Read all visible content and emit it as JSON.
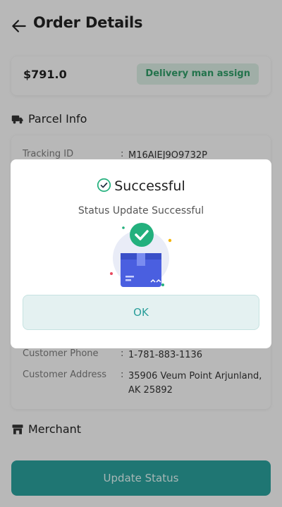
{
  "header": {
    "title": "Order Details"
  },
  "summary": {
    "price": "$791.0",
    "status": "Delivery man assign"
  },
  "parcel_info": {
    "title": "Parcel Info",
    "rows": [
      {
        "label": "Tracking ID",
        "value": "M16AIEJ9O9732P"
      },
      {
        "label": "Customer Phone",
        "value": "1-781-883-1136"
      },
      {
        "label": "Customer Address",
        "value": "35906 Veum Point Arjunland, AK 25892"
      }
    ]
  },
  "merchant": {
    "title": "Merchant"
  },
  "actions": {
    "update_status": "Update Status"
  },
  "dialog": {
    "title": "Successful",
    "message": "Status Update Successful",
    "ok": "OK"
  },
  "colors": {
    "accent": "#2a9e9a",
    "badge_bg": "#d6e9df",
    "badge_text": "#2f9a66",
    "success_green": "#23b07d"
  }
}
